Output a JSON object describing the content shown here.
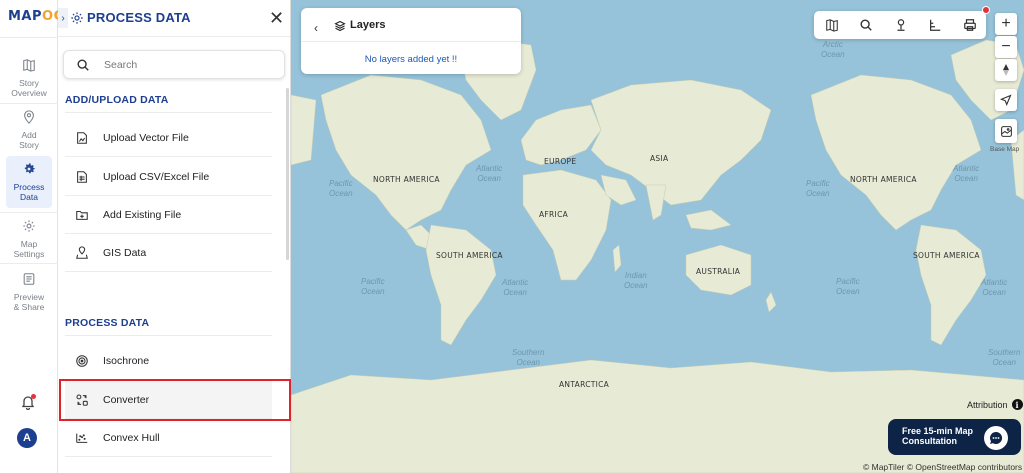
{
  "app": {
    "logo_main": "MAP",
    "logo_accent": "OG"
  },
  "rail": {
    "items": [
      {
        "label": "Story\nOverview",
        "icon": "book-map-icon"
      },
      {
        "label": "Add\nStory",
        "icon": "location-pin-icon"
      },
      {
        "label": "Process\nData",
        "icon": "gear-icon"
      },
      {
        "label": "Map\nSettings",
        "icon": "settings-icon"
      },
      {
        "label": "Preview\n& Share",
        "icon": "preview-icon"
      }
    ],
    "avatar_initial": "A"
  },
  "panel": {
    "title": "PROCESS DATA",
    "search_placeholder": "Search",
    "sections": [
      {
        "title": "ADD/UPLOAD DATA",
        "items": [
          "Upload Vector File",
          "Upload CSV/Excel File",
          "Add Existing File",
          "GIS Data"
        ]
      },
      {
        "title": "PROCESS DATA",
        "items": [
          "Isochrone",
          "Converter",
          "Convex Hull"
        ]
      }
    ]
  },
  "layers": {
    "title": "Layers",
    "empty_message": "No layers added yet !!"
  },
  "map": {
    "continents": [
      "NORTH AMERICA",
      "EUROPE",
      "ASIA",
      "AFRICA",
      "SOUTH AMERICA",
      "AUSTRALIA",
      "ANTARCTICA",
      "NORTH AMERICA",
      "SOUTH AMERICA"
    ],
    "oceans": [
      "Pacific\nOcean",
      "Atlantic\nOcean",
      "Pacific\nOcean",
      "Atlantic\nOcean",
      "Indian\nOcean",
      "Pacific\nOcean",
      "Atlantic\nOcean",
      "Southern\nOcean",
      "Southern\nOcean",
      "Pacific\nOcean",
      "Atlantic\nOcean",
      "Arctic\nOcean"
    ],
    "basemap_label": "Base Map",
    "attribution_label": "Attribution",
    "copyright": "© MapTiler © OpenStreetMap contributors"
  },
  "consult": {
    "label": "Free 15-min Map Consultation"
  },
  "colors": {
    "brand": "#1c3f8f",
    "accent": "#f2a22b",
    "highlight": "#e0232b",
    "water": "#96c3da",
    "land": "#e8ecd8"
  }
}
